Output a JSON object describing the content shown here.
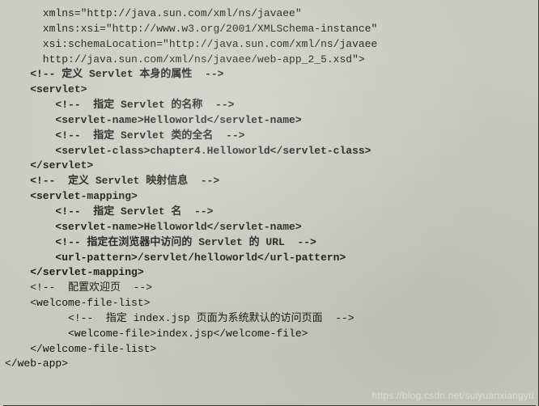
{
  "lines": [
    {
      "indent": 6,
      "bold": false,
      "text": "xmlns=\"http://java.sun.com/xml/ns/javaee\""
    },
    {
      "indent": 6,
      "bold": false,
      "text": "xmlns:xsi=\"http://www.w3.org/2001/XMLSchema-instance\""
    },
    {
      "indent": 6,
      "bold": false,
      "text": "xsi:schemaLocation=\"http://java.sun.com/xml/ns/javaee"
    },
    {
      "indent": 6,
      "bold": false,
      "text": "http://java.sun.com/xml/ns/javaee/web-app_2_5.xsd\">"
    },
    {
      "indent": 4,
      "bold": true,
      "text": "<!-- 定义 Servlet 本身的属性  -->"
    },
    {
      "indent": 4,
      "bold": true,
      "text": "<servlet>"
    },
    {
      "indent": 8,
      "bold": true,
      "text": "<!--  指定 Servlet 的名称  -->"
    },
    {
      "indent": 8,
      "bold": true,
      "text": "<servlet-name>Helloworld</servlet-name>"
    },
    {
      "indent": 8,
      "bold": true,
      "text": "<!--  指定 Servlet 类的全名  -->"
    },
    {
      "indent": 8,
      "bold": true,
      "text": "<servlet-class>chapter4.Helloworld</servlet-class>"
    },
    {
      "indent": 4,
      "bold": true,
      "text": "</servlet>"
    },
    {
      "indent": 4,
      "bold": true,
      "text": "<!--  定义 Servlet 映射信息  -->"
    },
    {
      "indent": 4,
      "bold": true,
      "text": "<servlet-mapping>"
    },
    {
      "indent": 8,
      "bold": true,
      "text": "<!--  指定 Servlet 名  -->"
    },
    {
      "indent": 8,
      "bold": true,
      "text": "<servlet-name>Helloworld</servlet-name>"
    },
    {
      "indent": 8,
      "bold": true,
      "text": "<!-- 指定在浏览器中访问的 Servlet 的 URL  -->"
    },
    {
      "indent": 8,
      "bold": true,
      "text": "<url-pattern>/servlet/helloworld</url-pattern>"
    },
    {
      "indent": 4,
      "bold": true,
      "text": "</servlet-mapping>"
    },
    {
      "indent": 4,
      "bold": false,
      "text": "<!--  配置欢迎页  -->"
    },
    {
      "indent": 4,
      "bold": false,
      "text": "<welcome-file-list>"
    },
    {
      "indent": 10,
      "bold": false,
      "text": "<!--  指定 index.jsp 页面为系统默认的访问页面  -->"
    },
    {
      "indent": 10,
      "bold": false,
      "text": "<welcome-file>index.jsp</welcome-file>"
    },
    {
      "indent": 4,
      "bold": false,
      "text": "</welcome-file-list>"
    },
    {
      "indent": 0,
      "bold": false,
      "text": "</web-app>"
    }
  ],
  "watermark": "https://blog.csdn.net/suiyuanxiangyu"
}
